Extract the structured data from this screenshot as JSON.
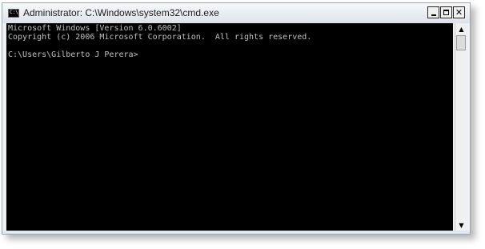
{
  "window": {
    "title": "Administrator: C:\\Windows\\system32\\cmd.exe",
    "icon": "console-icon",
    "icon_text": "C:\\",
    "buttons": {
      "minimize": "minimize-icon",
      "maximize": "maximize-icon",
      "close": "close-icon",
      "close_glyph": "✕"
    }
  },
  "console": {
    "lines": [
      "Microsoft Windows [Version 6.0.6002]",
      "Copyright (c) 2006 Microsoft Corporation.  All rights reserved.",
      "",
      "C:\\Users\\Gilberto J Perera>"
    ],
    "background": "#000000",
    "foreground": "#c0c0c0"
  },
  "scrollbar": {
    "up_glyph": "▲",
    "down_glyph": "▼"
  }
}
